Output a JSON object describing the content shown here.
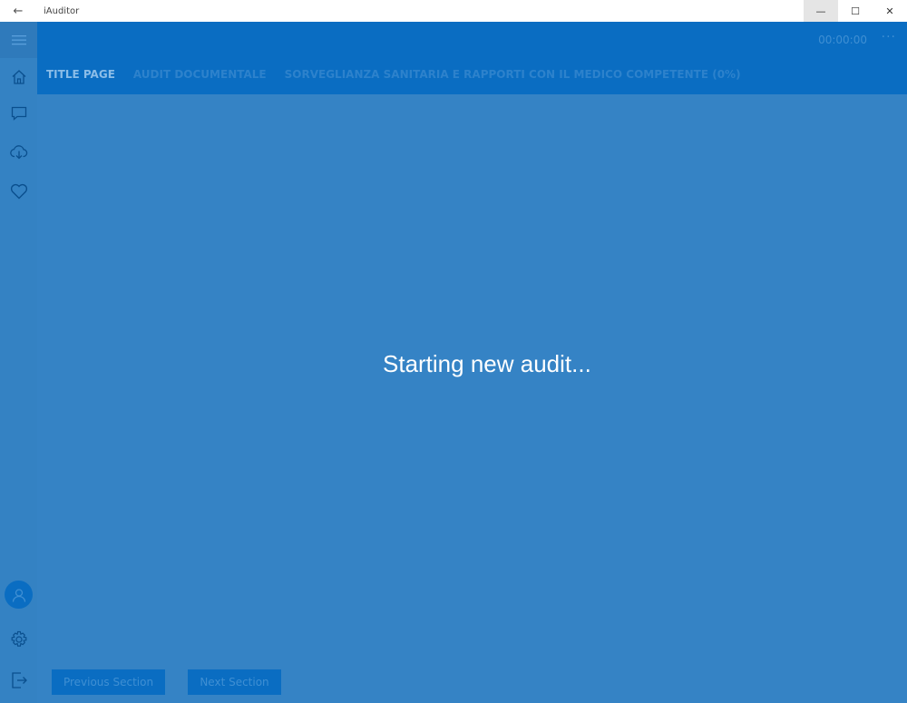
{
  "window": {
    "title": "iAuditor",
    "back_glyph": "←",
    "minimize_glyph": "—",
    "maximize_glyph": "☐",
    "close_glyph": "✕"
  },
  "header": {
    "timer": "00:00:00",
    "more_glyph": "···",
    "tabs": [
      {
        "label": "TITLE PAGE",
        "active": true
      },
      {
        "label": "AUDIT DOCUMENTALE",
        "active": false
      },
      {
        "label": "SORVEGLIANZA SANITARIA E RAPPORTI CON IL MEDICO COMPETENTE (0%)",
        "active": false
      }
    ]
  },
  "sidebar": {
    "icons": [
      "hamburger-icon",
      "home-icon",
      "chat-icon",
      "cloud-download-icon",
      "heart-icon",
      "user-icon",
      "gear-icon",
      "sign-out-icon"
    ]
  },
  "main": {
    "loading_text": "Starting new audit...",
    "previous_label": "Previous Section",
    "next_label": "Next Section"
  },
  "colors": {
    "accent": "#0a6dc2",
    "overlay": "#3583c5",
    "sidebar": "#3482c3"
  }
}
